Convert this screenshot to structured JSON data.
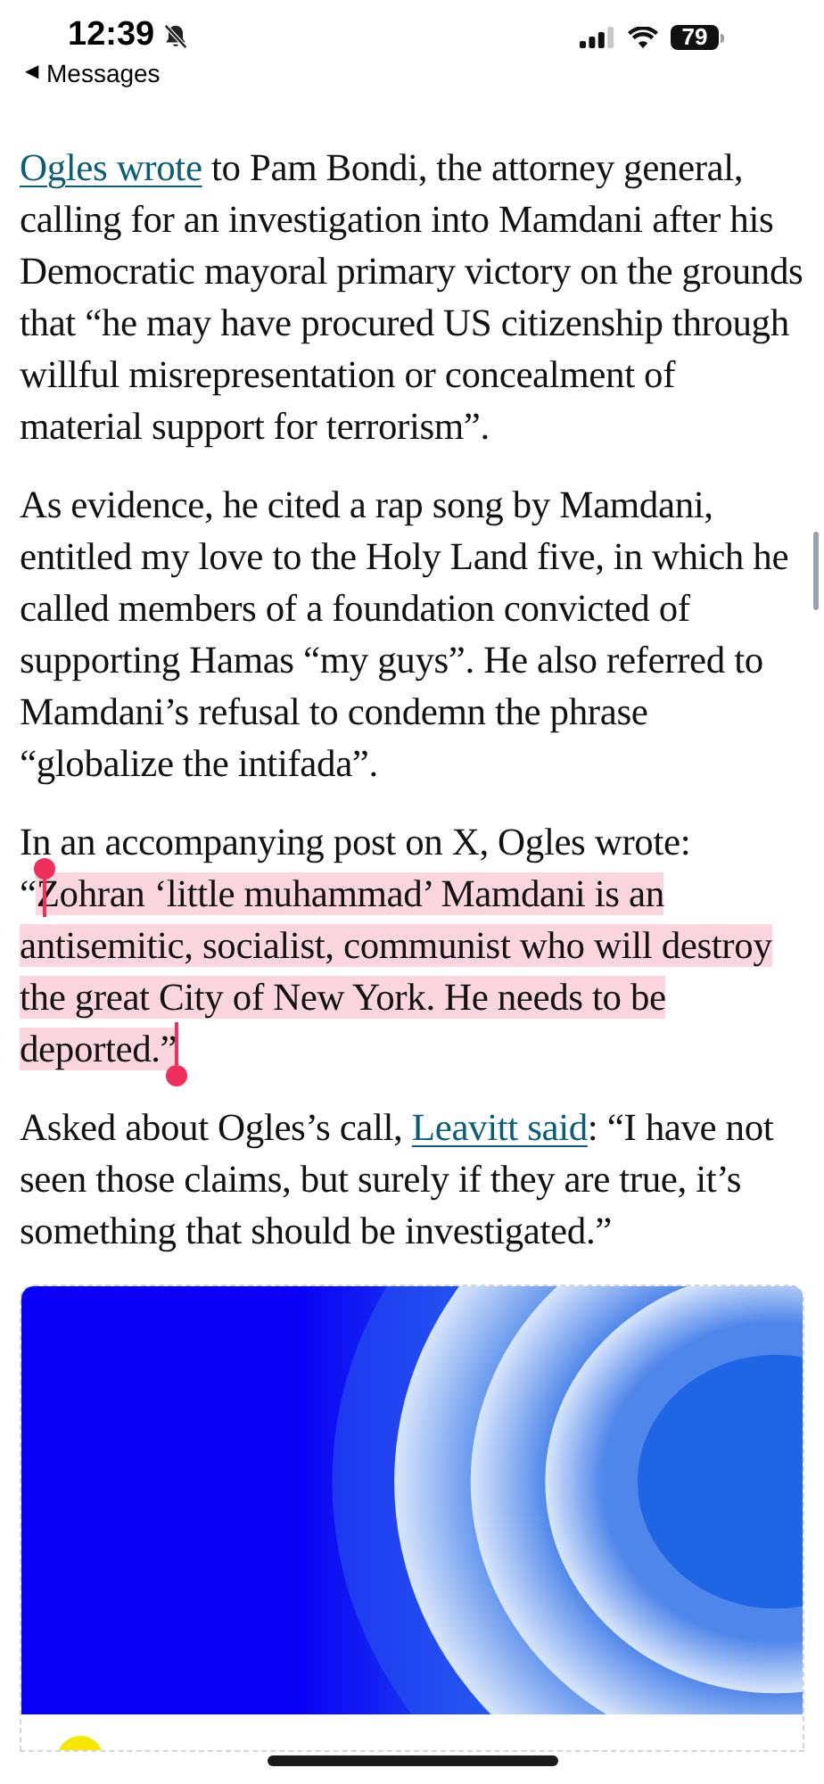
{
  "status_bar": {
    "time": "12:39",
    "back": {
      "glyph": "◀",
      "label": "Messages"
    },
    "battery": "79",
    "silent": true
  },
  "article": {
    "paragraphs": [
      {
        "segments": [
          {
            "kind": "link",
            "text": "Ogles wrote",
            "selected": false
          },
          {
            "kind": "text",
            "text": " to Pam Bondi, the attorney general, calling for an investigation into Mamdani after his Democratic mayoral primary victory on the grounds that “he may have procured US citizenship through willful misrepresentation or concealment of material support for terrorism”.",
            "selected": false
          }
        ]
      },
      {
        "segments": [
          {
            "kind": "text",
            "text": "As evidence, he cited a rap song by Mamdani, entitled my love to the Holy Land five, in which he called members of a foundation convicted of supporting Hamas “my guys”. He also referred to Mamdani’s refusal to condemn the phrase “globalize the intifada”.",
            "selected": false
          }
        ]
      },
      {
        "segments": [
          {
            "kind": "text",
            "text": "In an accompanying post on X, Ogles wrote: “",
            "selected": false
          },
          {
            "kind": "text",
            "text": "Zohran ‘little muhammad’ Mamdani is an antisemitic, socialist, communist who will destroy the great City of New York. He needs to be deported.”",
            "selected": true
          }
        ]
      },
      {
        "segments": [
          {
            "kind": "text",
            "text": "Asked about Ogles’s call, ",
            "selected": false
          },
          {
            "kind": "link",
            "text": "Leavitt said",
            "selected": false
          },
          {
            "kind": "text",
            "text": ": “I have not seen those claims, but surely if they are true, it’s something that should be investigated.”",
            "selected": false
          }
        ]
      }
    ]
  }
}
